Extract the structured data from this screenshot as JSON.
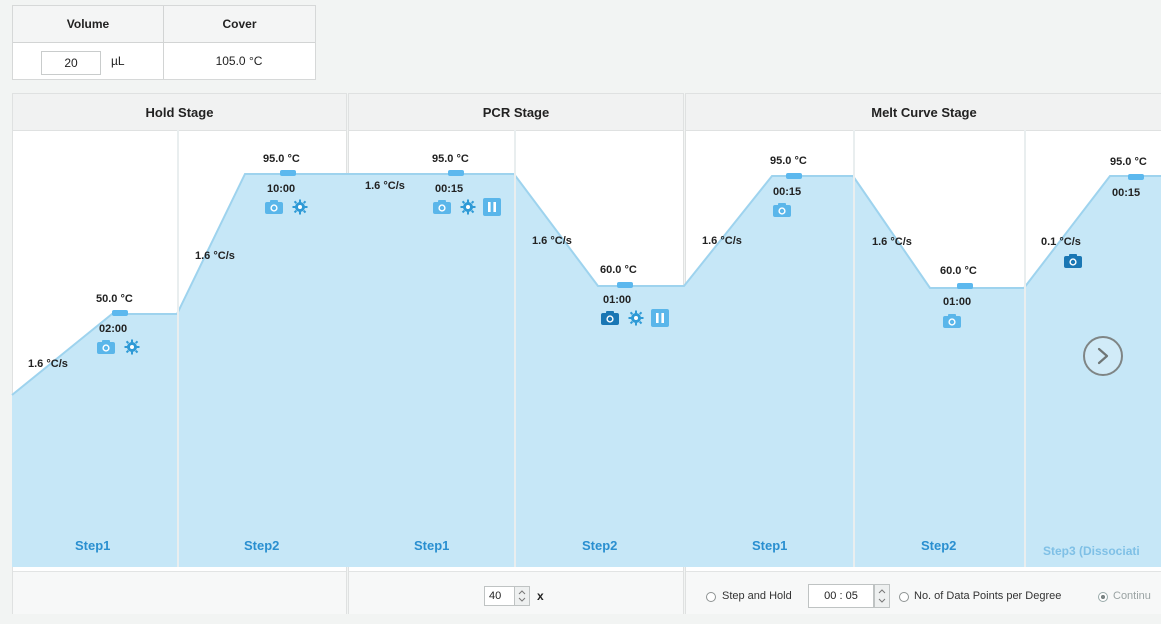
{
  "settings": {
    "volume_header": "Volume",
    "cover_header": "Cover",
    "volume_value": "20",
    "volume_unit": "µL",
    "cover_value": "105.0 °C"
  },
  "stages": [
    {
      "name": "Hold Stage",
      "steps": [
        {
          "label": "Step1",
          "temp": "50.0 °C",
          "time": "02:00",
          "ramp": "1.6 °C/s",
          "icons": [
            "camera-icon",
            "gear-icon"
          ]
        },
        {
          "label": "Step2",
          "temp": "95.0 °C",
          "time": "10:00",
          "ramp": "1.6 °C/s",
          "icons": [
            "camera-icon",
            "gear-icon"
          ]
        }
      ]
    },
    {
      "name": "PCR Stage",
      "cycles": "40",
      "cycles_suffix": "x",
      "steps": [
        {
          "label": "Step1",
          "temp": "95.0 °C",
          "time": "00:15",
          "ramp": "1.6 °C/s",
          "icons": [
            "camera-icon",
            "gear-icon",
            "pause-icon"
          ]
        },
        {
          "label": "Step2",
          "temp": "60.0 °C",
          "time": "01:00",
          "ramp": "1.6 °C/s",
          "icons": [
            "camera-icon",
            "gear-icon",
            "pause-icon"
          ]
        }
      ]
    },
    {
      "name": "Melt Curve Stage",
      "steps": [
        {
          "label": "Step1",
          "temp": "95.0 °C",
          "time": "00:15",
          "ramp": "1.6 °C/s",
          "icons": [
            "camera-icon"
          ]
        },
        {
          "label": "Step2",
          "temp": "60.0 °C",
          "time": "01:00",
          "ramp": "1.6 °C/s",
          "icons": [
            "camera-icon"
          ]
        },
        {
          "label": "Step3 (Dissociati",
          "temp": "95.0 °C",
          "time": "00:15",
          "ramp": "0.1 °C/s",
          "icons": [
            "camera-icon"
          ]
        }
      ],
      "footer": {
        "step_and_hold": "Step and Hold",
        "hold_value": "00 : 05",
        "data_points": "No. of Data Points per Degree",
        "continuous": "Continu"
      }
    }
  ],
  "colors": {
    "fill": "#c6e7f7",
    "edge": "#a9d9f1",
    "step_label": "#2a8fd0",
    "icon_blue": "#2e9ad6",
    "icon_blue_dark": "#1a77b4"
  }
}
